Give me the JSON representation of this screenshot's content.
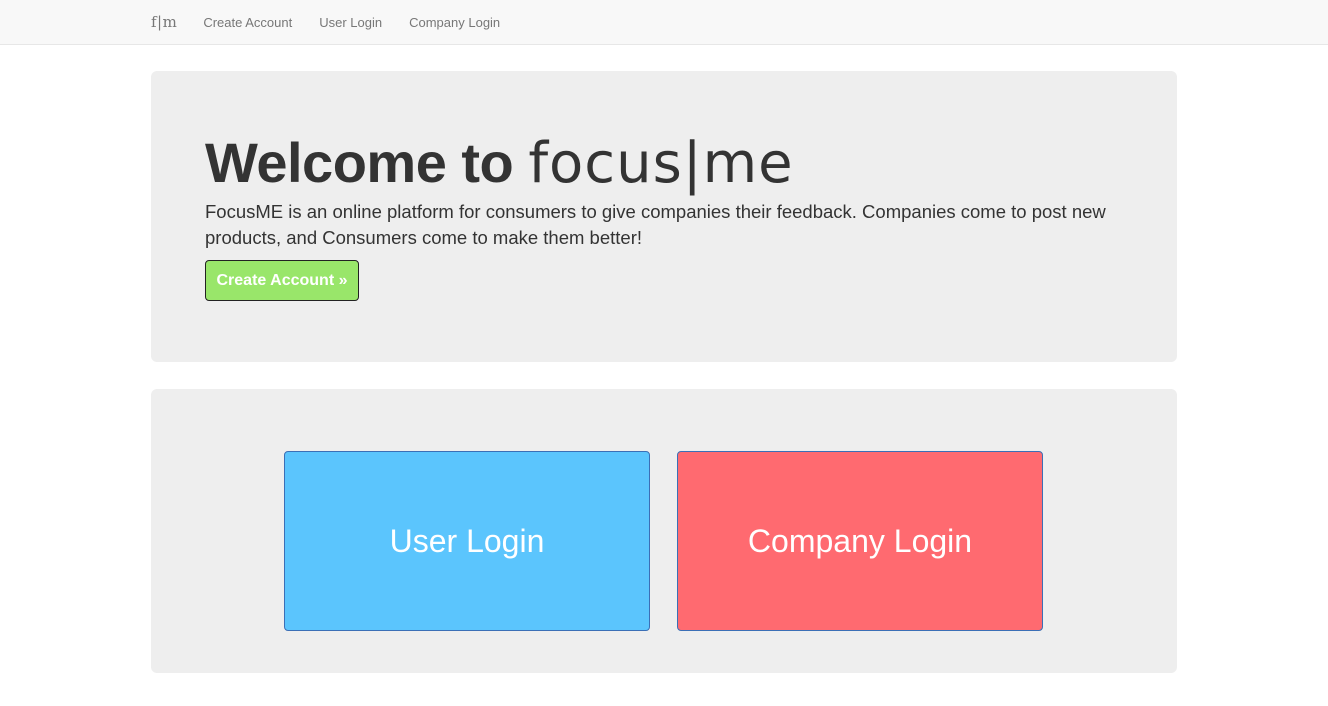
{
  "navbar": {
    "brand": "f|m",
    "links": [
      {
        "label": "Create Account"
      },
      {
        "label": "User Login"
      },
      {
        "label": "Company Login"
      }
    ]
  },
  "hero": {
    "title_prefix": "Welcome to ",
    "title_logo": "focus|me",
    "description": "FocusME is an online platform for consumers to give companies their feedback. Companies come to post new products, and Consumers come to make them better!",
    "cta_label": "Create Account »"
  },
  "login": {
    "user_label": "User Login",
    "company_label": "Company Login"
  },
  "colors": {
    "cta": "#99e66a",
    "user_login": "#5bc5fd",
    "company_login": "#ff6a70",
    "panel_bg": "#eeeeee"
  }
}
